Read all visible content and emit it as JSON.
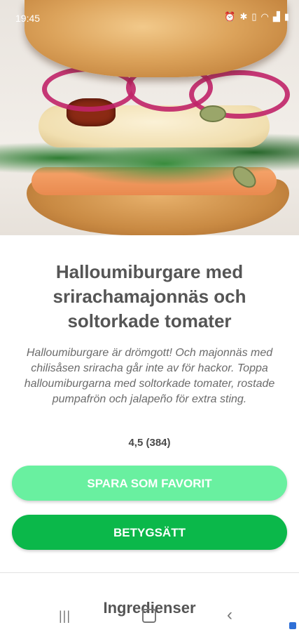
{
  "status_bar": {
    "time": "19:45",
    "icons": [
      "alarm-icon",
      "bluetooth-icon",
      "vibrate-icon",
      "wifi-icon",
      "signal-icon",
      "battery-icon"
    ]
  },
  "recipe": {
    "title": "Halloumiburgare med srirachamajonnäs och soltorkade tomater",
    "description": "Halloumiburgare är drömgott! Och majonnäs med chilisåsen sriracha går inte av för hackor. Toppa halloumiburgarna med soltorkade tomater, rostade pumpafrön och jalapeño för extra sting.",
    "rating": "4,5 (384)"
  },
  "buttons": {
    "favorite_label": "SPARA SOM FAVORIT",
    "rate_label": "BETYGSÄTT"
  },
  "section": {
    "ingredients_heading": "Ingredienser"
  },
  "colors": {
    "favorite_button": "#69f0a0",
    "rate_button": "#0bb84a",
    "title_text": "#555555"
  }
}
